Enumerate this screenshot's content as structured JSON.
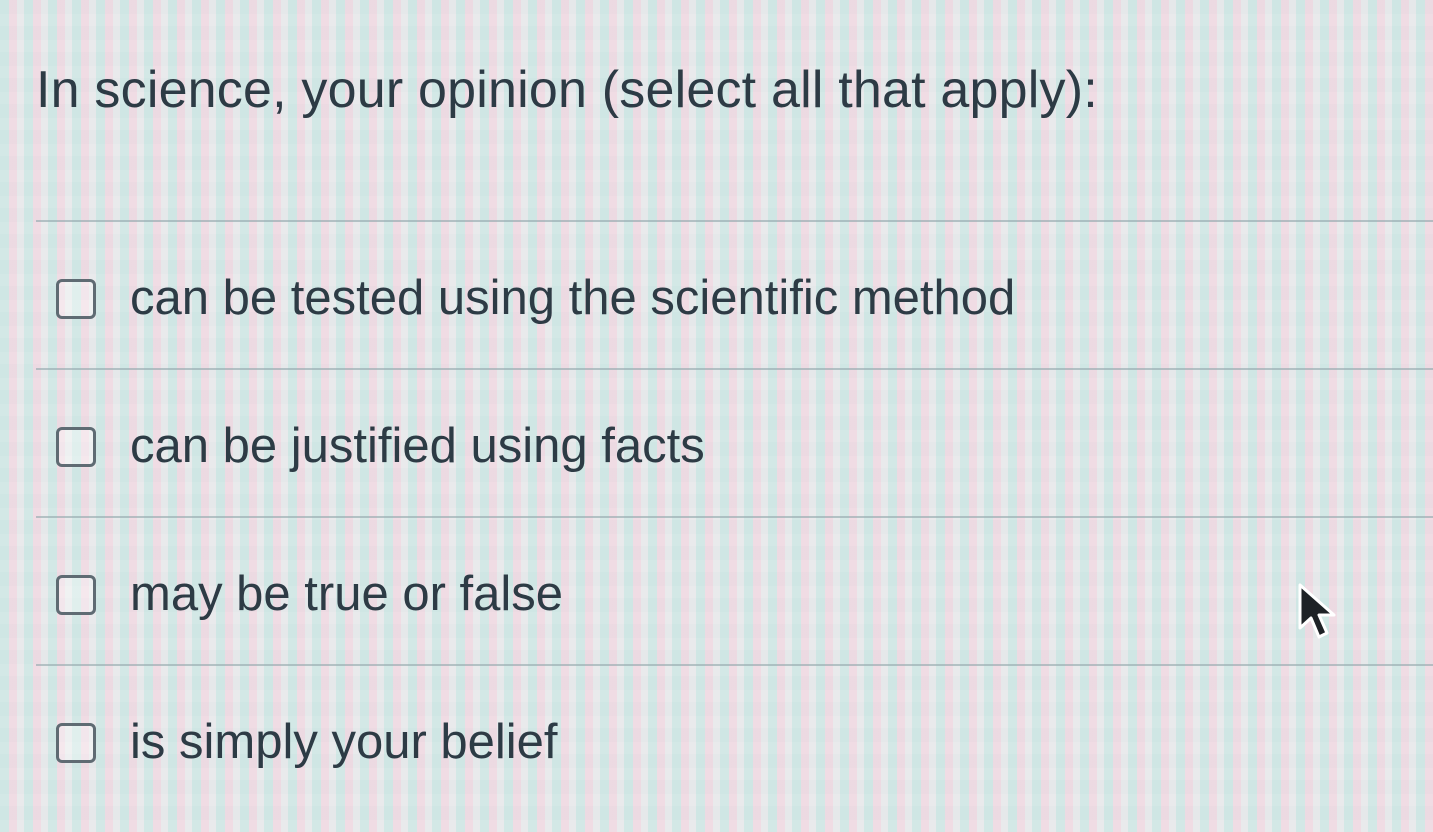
{
  "question": {
    "text": "In science, your opinion (select all that apply):"
  },
  "answers": [
    {
      "label": "can be tested using the scientific method",
      "checked": false
    },
    {
      "label": "can be justified using facts",
      "checked": false
    },
    {
      "label": "may be true or false",
      "checked": false
    },
    {
      "label": "is simply your belief",
      "checked": false
    }
  ],
  "icons": {
    "cursor": "mouse-pointer-icon"
  }
}
